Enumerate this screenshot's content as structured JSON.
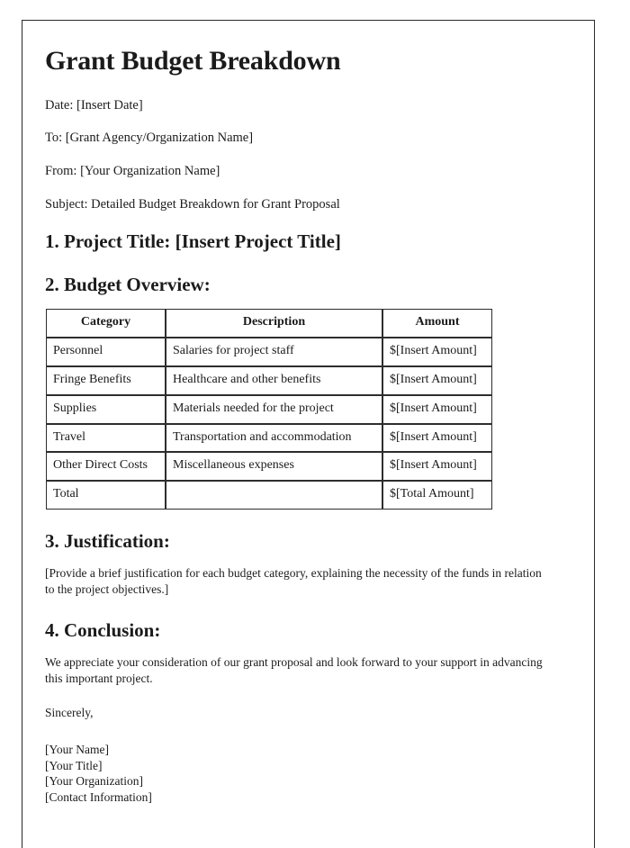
{
  "document": {
    "title": "Grant Budget Breakdown",
    "meta_lines": [
      "Date: [Insert Date]",
      "To: [Grant Agency/Organization Name]",
      "From: [Your Organization Name]",
      "Subject: Detailed Budget Breakdown for Grant Proposal"
    ],
    "sections": {
      "project_title_heading": "1. Project Title: [Insert Project Title]",
      "budget_overview_heading": "2. Budget Overview:",
      "justification_heading": "3. Justification:",
      "justification_text": "[Provide a brief justification for each budget category, explaining the necessity of the funds in relation to the project objectives.]",
      "conclusion_heading": "4. Conclusion:",
      "conclusion_text": "We appreciate your consideration of our grant proposal and look forward to your support in advancing this important project.",
      "sign_off": "Sincerely,"
    },
    "budget_table": {
      "headers": [
        "Category",
        "Description",
        "Amount"
      ],
      "rows": [
        [
          "Personnel",
          "Salaries for project staff",
          "$[Insert Amount]"
        ],
        [
          "Fringe Benefits",
          "Healthcare and other benefits",
          "$[Insert Amount]"
        ],
        [
          "Supplies",
          "Materials needed for the project",
          "$[Insert Amount]"
        ],
        [
          "Travel",
          "Transportation and accommodation",
          "$[Insert Amount]"
        ],
        [
          "Other Direct Costs",
          "Miscellaneous expenses",
          "$[Insert Amount]"
        ],
        [
          "Total",
          "",
          "$[Total Amount]"
        ]
      ]
    },
    "signature_block": [
      "[Your Name]",
      "[Your Title]",
      "[Your Organization]",
      "[Contact Information]"
    ],
    "colors": {
      "text": "#1b1b1b",
      "page_border": "#2a2a2a",
      "table_border": "#2d2d2d",
      "background": "#ffffff"
    }
  }
}
